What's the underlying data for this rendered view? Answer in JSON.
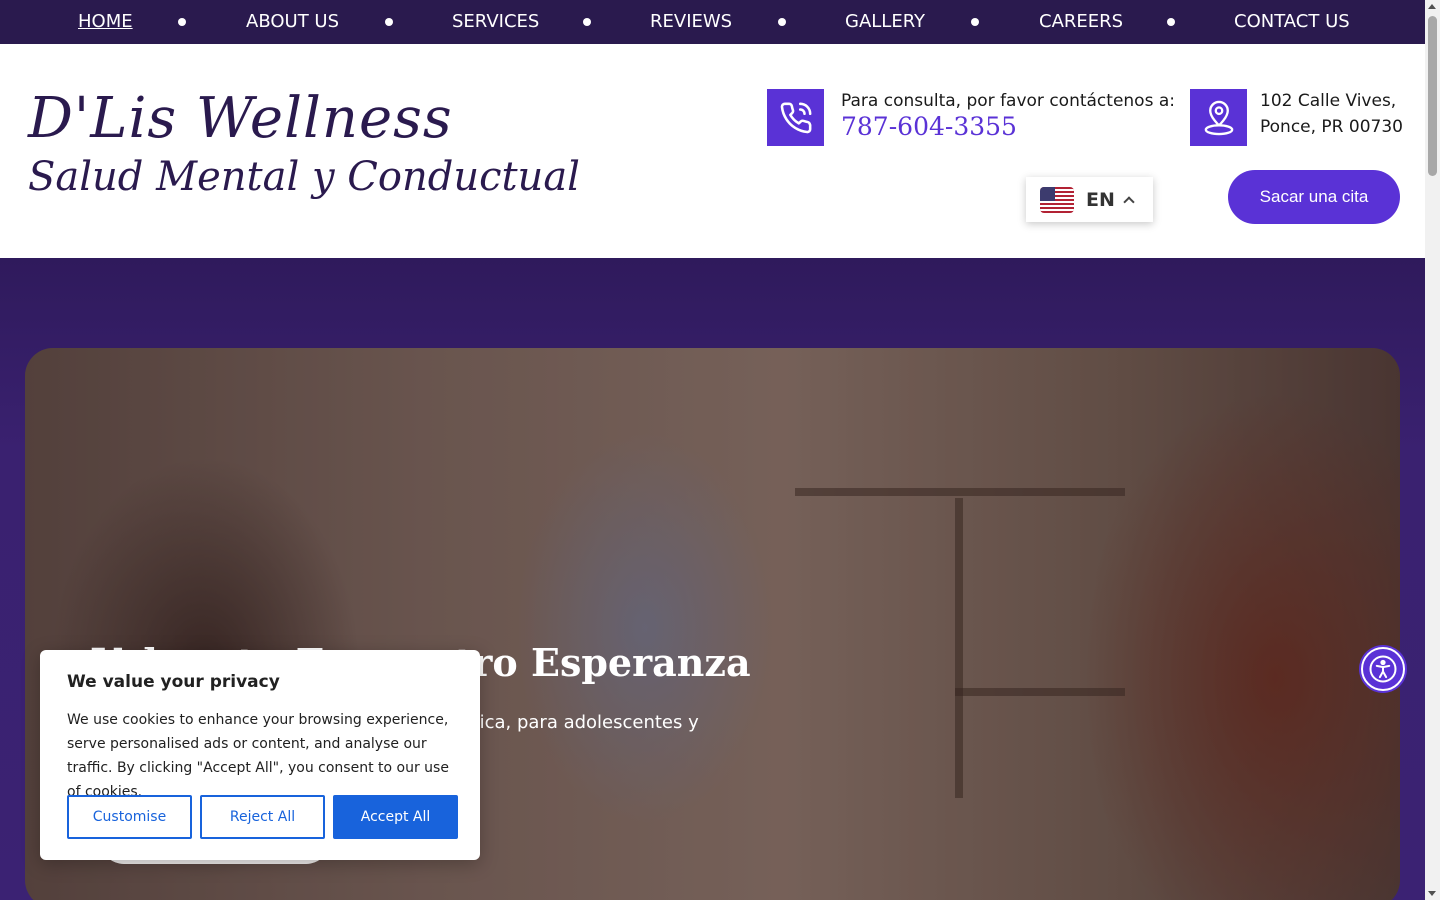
{
  "nav": {
    "items": [
      {
        "label": "HOME",
        "active": true
      },
      {
        "label": "ABOUT US"
      },
      {
        "label": "SERVICES"
      },
      {
        "label": "REVIEWS"
      },
      {
        "label": "GALLERY"
      },
      {
        "label": "CAREERS"
      },
      {
        "label": "CONTACT US"
      }
    ]
  },
  "header": {
    "logo_line1": "D'Lis Wellness",
    "logo_line2": "Salud Mental y Conductual",
    "phone_label": "Para consulta, por favor contáctenos a:",
    "phone_number": "787-604-3355",
    "address_line1": "102 Calle Vives,",
    "address_line2": "Ponce, PR 00730",
    "language_code": "EN",
    "cta_label": "Sacar una cita"
  },
  "hero": {
    "title": "Volver tu Encuentro Esperanza",
    "text": "Ofrecemos servicios de salud mental holística, para adolescentes y personas mayores. ¡Comience"
  },
  "cookie": {
    "title": "We value your privacy",
    "text": "We use cookies to enhance your browsing experience, serve personalised ads or content, and analyse our traffic. By clicking \"Accept All\", you consent to our use of cookies.",
    "customise": "Customise",
    "reject": "Reject All",
    "accept": "Accept All"
  },
  "colors": {
    "nav_bg": "#2a1a4e",
    "accent": "#5a32d6",
    "cookie_blue": "#1863dc"
  },
  "icons": {
    "phone": "phone-icon",
    "location": "map-pin-icon",
    "accessibility": "accessibility-icon",
    "flag": "us-flag-icon"
  }
}
